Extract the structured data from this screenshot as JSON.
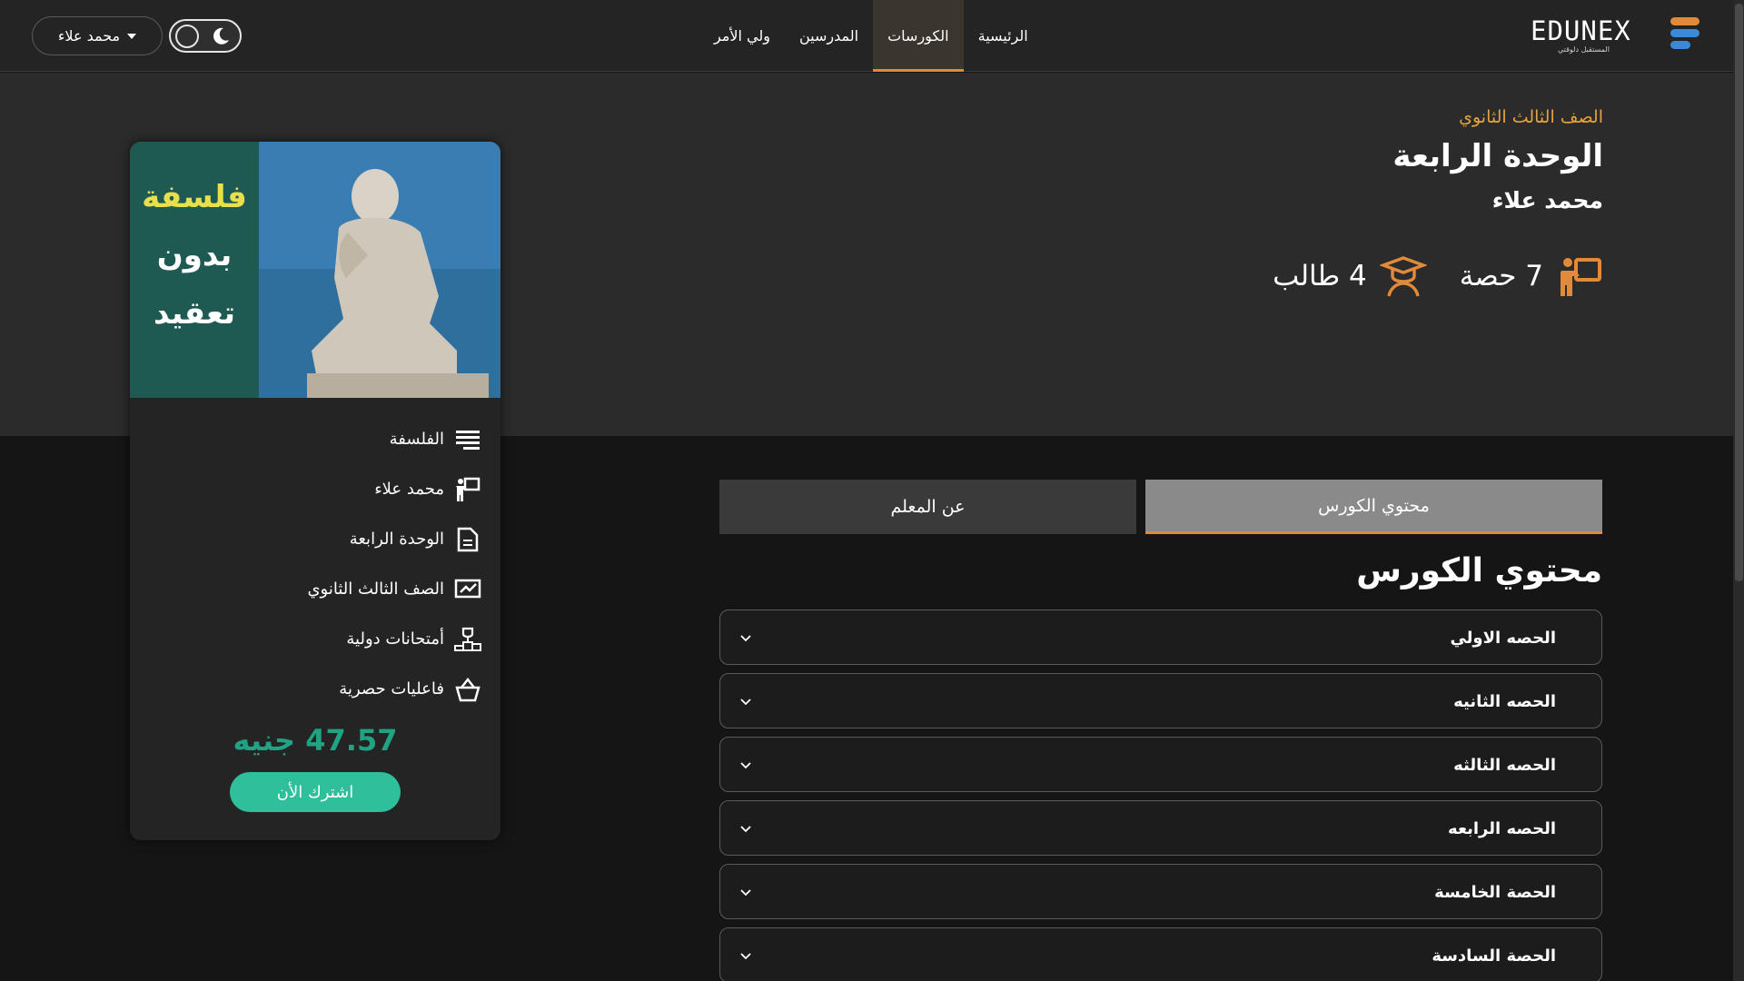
{
  "nav": {
    "logo_text": "EDUNEX",
    "logo_sub": "المستقبل دلوقتي",
    "links": [
      "الرئيسية",
      "الكورسات",
      "المدرسين",
      "ولي الأمر"
    ],
    "active_link": "الكورسات",
    "user_name": "محمد علاء"
  },
  "hero": {
    "grade": "الصف الثالث الثانوي",
    "title": "الوحدة الرابعة",
    "teacher": "محمد علاء",
    "lessons_count": "7 حصة",
    "students_count": "4 طالب"
  },
  "tabs": {
    "content": "محتوي الكورس",
    "teacher": "عن المعلم"
  },
  "section": {
    "title": "محتوي الكورس"
  },
  "lessons": [
    "الحصه الاولي",
    "الحصه الثانيه",
    "الحصه الثالثه",
    "الحصه الرابعه",
    "الحصة الخامسة",
    "الحصة السادسة"
  ],
  "card": {
    "image_text": [
      "فلسفة",
      "بدون",
      "تعقيد"
    ],
    "info": {
      "subject": "الفلسفة",
      "teacher": "محمد علاء",
      "unit": "الوحدة الرابعة",
      "grade": "الصف الثالث الثانوي",
      "exams": "أمتحانات دولية",
      "events": "فاعليات حصرية"
    },
    "price": "47.57 جنيه",
    "subscribe_label": "اشترك الأن"
  },
  "colors": {
    "accent": "#e08a3a",
    "grade_text": "#e6a23c",
    "price": "#21a383",
    "button": "#2fbf9a"
  }
}
